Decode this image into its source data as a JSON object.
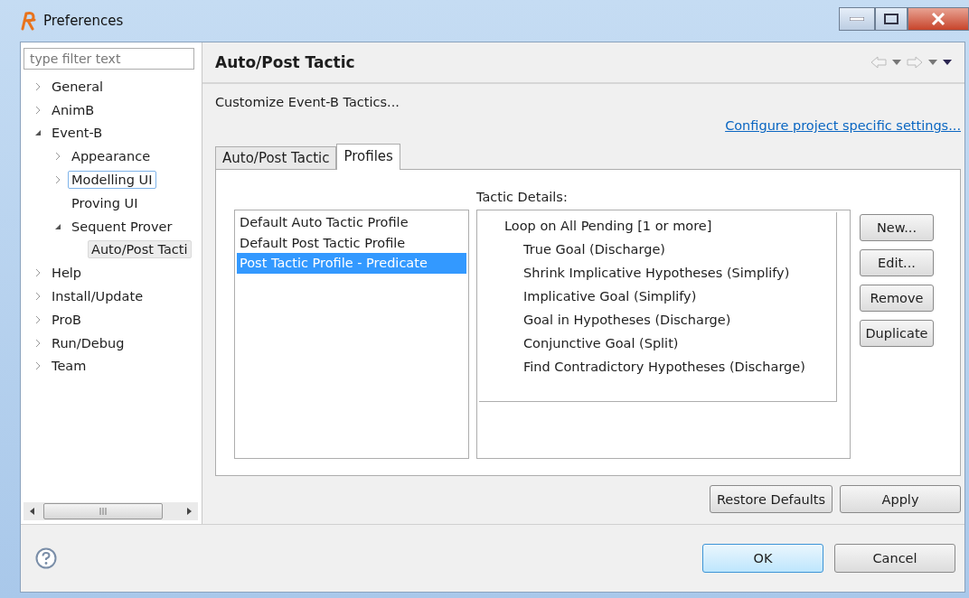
{
  "window": {
    "title": "Preferences"
  },
  "filter": {
    "placeholder": "type filter text"
  },
  "tree": [
    {
      "label": "General",
      "expanded": false,
      "selected": false,
      "hovered": false
    },
    {
      "label": "AnimB",
      "expanded": false,
      "selected": false,
      "hovered": false
    },
    {
      "label": "Event-B",
      "expanded": true,
      "selected": false,
      "hovered": false,
      "children": [
        {
          "label": "Appearance",
          "expanded": false,
          "selected": false,
          "hovered": false
        },
        {
          "label": "Modelling UI",
          "expanded": false,
          "selected": false,
          "hovered": true
        },
        {
          "label": "Proving UI",
          "selected": false,
          "hovered": false
        },
        {
          "label": "Sequent Prover",
          "expanded": true,
          "selected": false,
          "hovered": false,
          "children": [
            {
              "label": "Auto/Post Tacti",
              "selected": true,
              "hovered": false
            }
          ]
        }
      ]
    },
    {
      "label": "Help",
      "expanded": false,
      "selected": false,
      "hovered": false
    },
    {
      "label": "Install/Update",
      "expanded": false,
      "selected": false,
      "hovered": false
    },
    {
      "label": "ProB",
      "expanded": false,
      "selected": false,
      "hovered": false
    },
    {
      "label": "Run/Debug",
      "expanded": false,
      "selected": false,
      "hovered": false
    },
    {
      "label": "Team",
      "expanded": false,
      "selected": false,
      "hovered": false
    }
  ],
  "page": {
    "title": "Auto/Post Tactic",
    "description": "Customize Event-B Tactics...",
    "link": "Configure project specific settings...",
    "tabs": [
      {
        "label": "Auto/Post Tactic",
        "selected": false
      },
      {
        "label": "Profiles",
        "selected": true
      }
    ],
    "details_label": "Tactic Details:",
    "profiles": [
      {
        "label": "Default Auto Tactic Profile",
        "selected": false
      },
      {
        "label": "Default Post Tactic Profile",
        "selected": false
      },
      {
        "label": "Post Tactic Profile - Predicate",
        "selected": true
      }
    ],
    "details": [
      {
        "label": "Loop on All Pending [1 or more]",
        "children": [
          {
            "label": "True Goal (Discharge)"
          },
          {
            "label": "Shrink Implicative Hypotheses (Simplify)"
          },
          {
            "label": "Implicative Goal (Simplify)"
          },
          {
            "label": "Goal in Hypotheses (Discharge)"
          },
          {
            "label": "Conjunctive Goal (Split)"
          },
          {
            "label": "Find Contradictory Hypotheses (Discharge)"
          }
        ]
      }
    ],
    "side_buttons": [
      "New...",
      "Edit...",
      "Remove",
      "Duplicate"
    ],
    "page_buttons": [
      "Restore Defaults",
      "Apply"
    ]
  },
  "dialog_buttons": [
    {
      "label": "OK",
      "default": true
    },
    {
      "label": "Cancel",
      "default": false
    }
  ]
}
